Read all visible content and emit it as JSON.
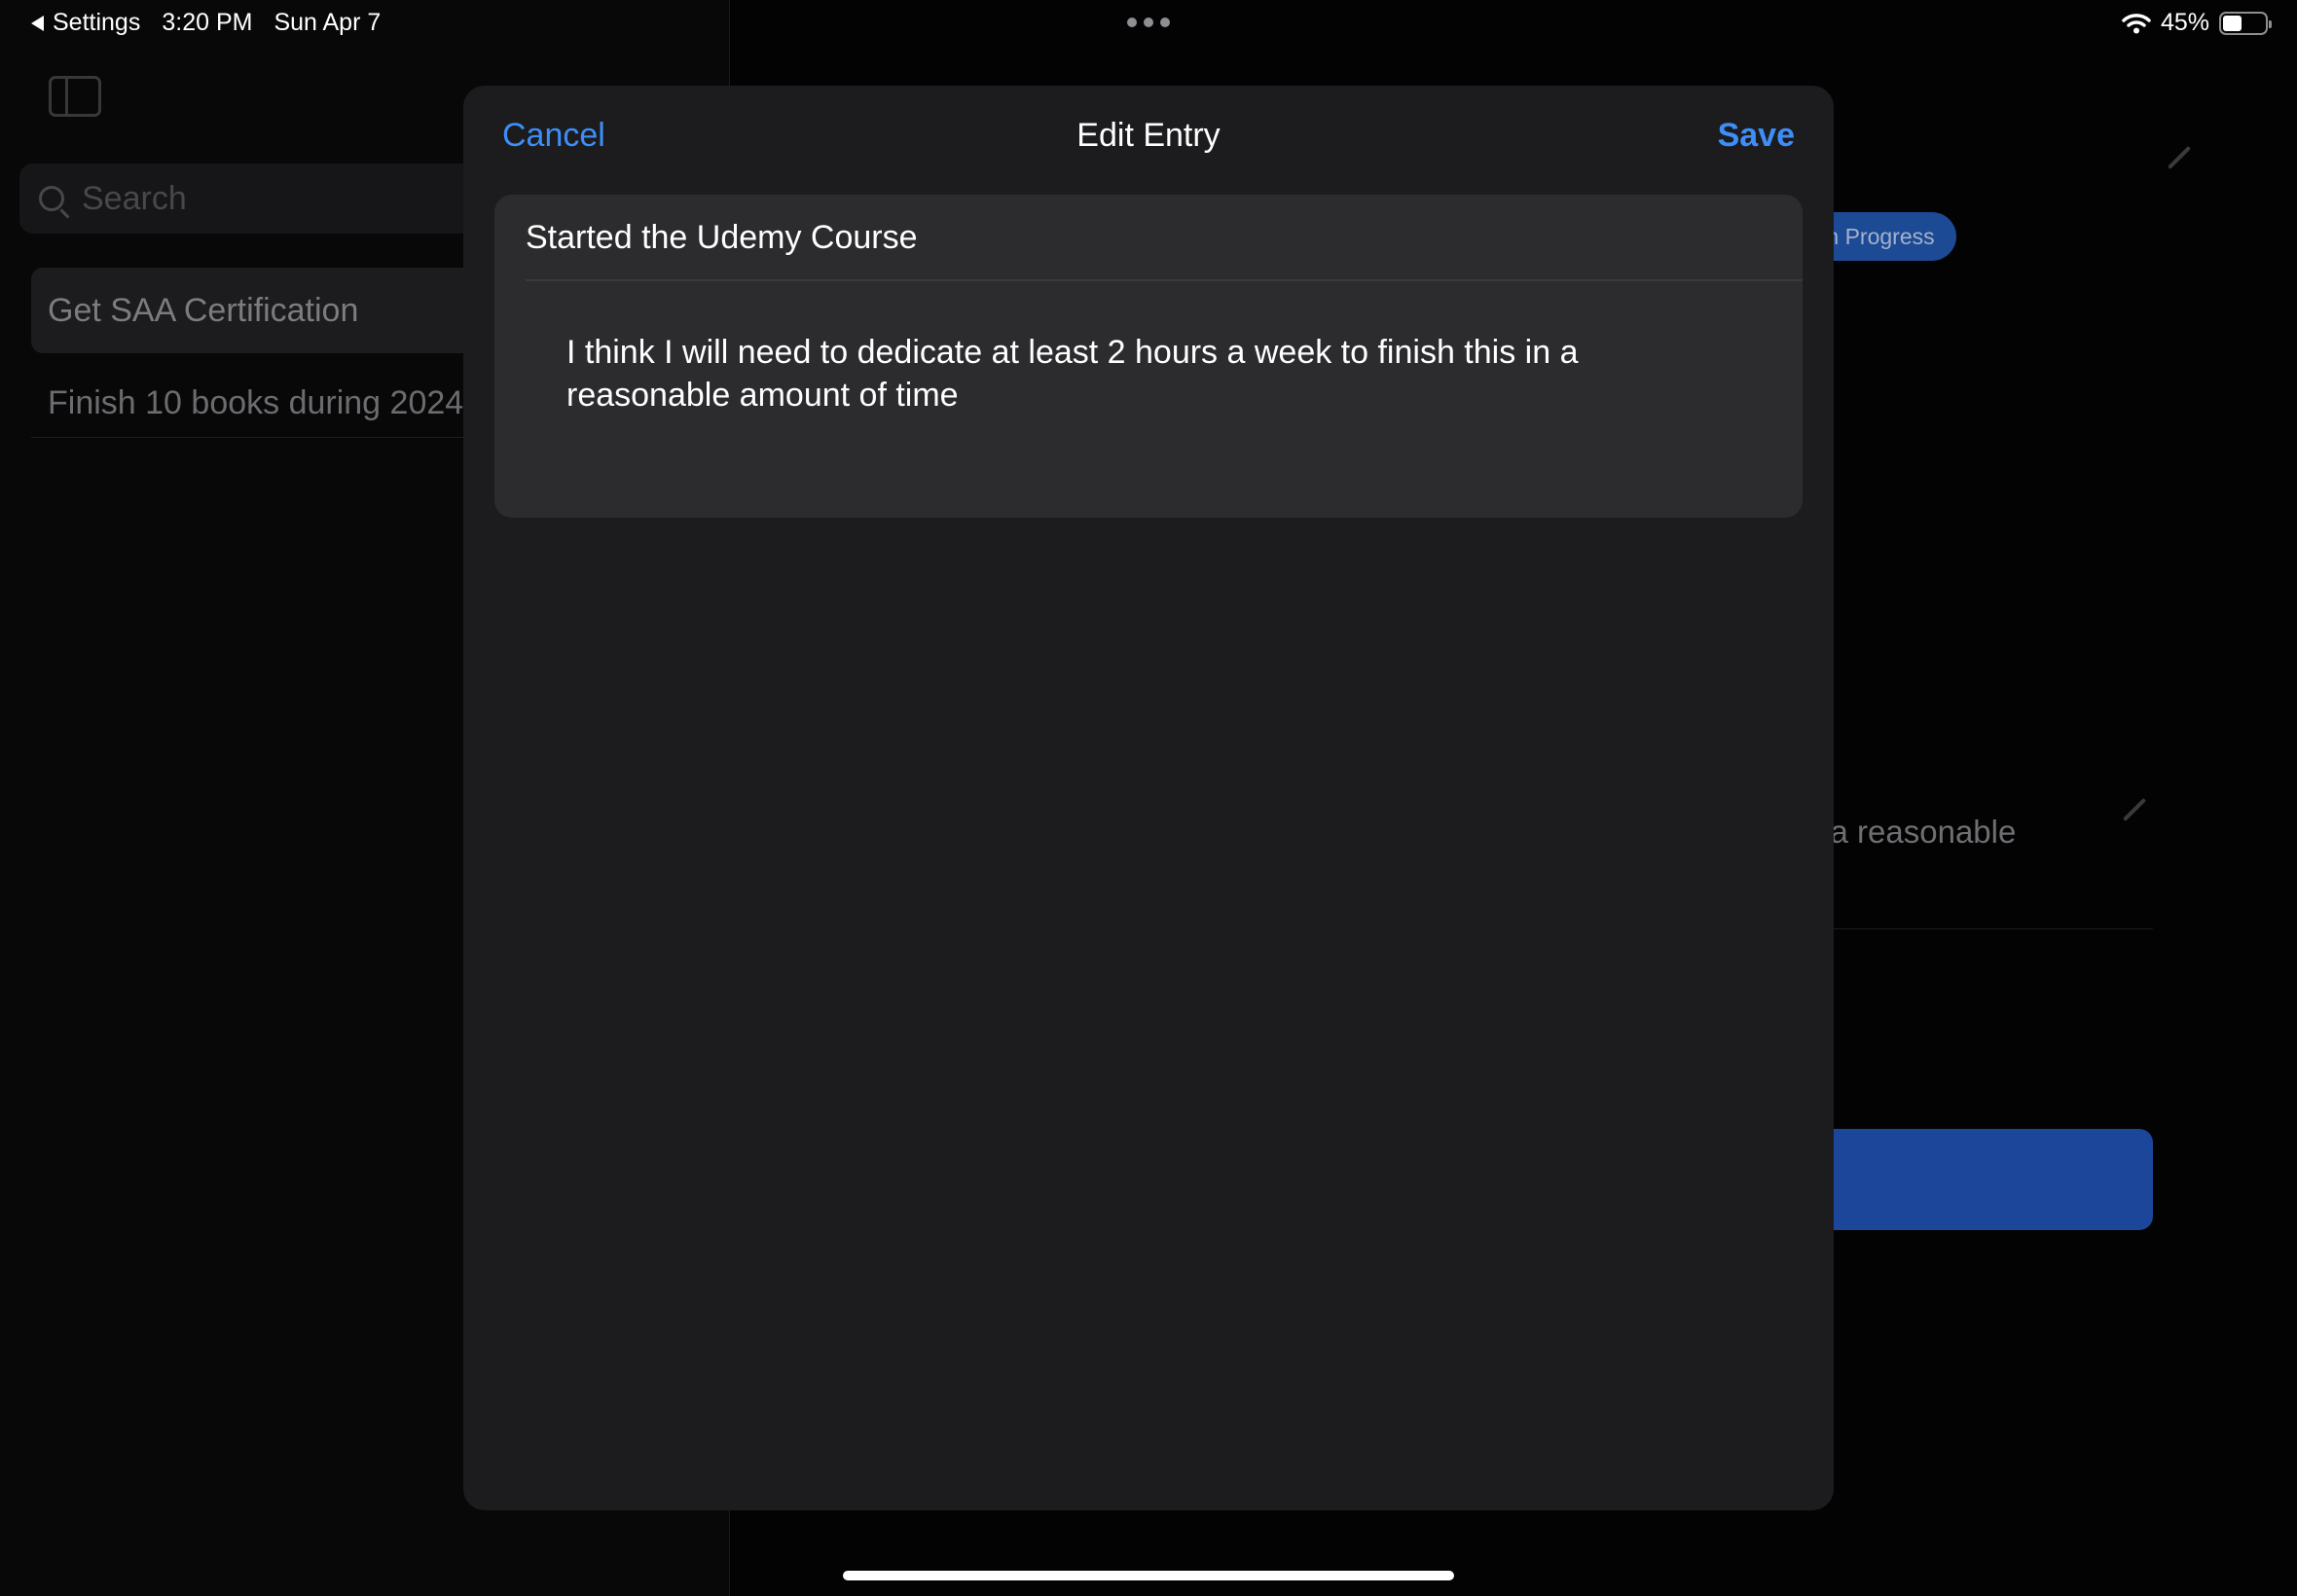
{
  "status_bar": {
    "back_app": "Settings",
    "time": "3:20 PM",
    "date": "Sun Apr 7",
    "battery": "45%",
    "battery_level": 0.45,
    "icons": [
      "wifi-icon",
      "battery-icon"
    ]
  },
  "sidebar": {
    "search_placeholder": "Search",
    "items": [
      {
        "label": "Get SAA Certification",
        "selected": true
      },
      {
        "label": "Finish 10 books during 2024"
      }
    ]
  },
  "detail": {
    "status_badge": "In Progress",
    "entry_text_tail": "s in a reasonable"
  },
  "modal": {
    "cancel_label": "Cancel",
    "title": "Edit Entry",
    "save_label": "Save",
    "entry_title_value": "Started the Udemy Course",
    "entry_body_value": "I think I will need to dedicate at least 2 hours a week to finish this in a reasonable amount of time"
  },
  "colors": {
    "accent": "#3d8ef7",
    "sheet_background": "#1c1c1e",
    "field_background": "#2c2c2e",
    "badge_blue": "#1d4a94"
  }
}
